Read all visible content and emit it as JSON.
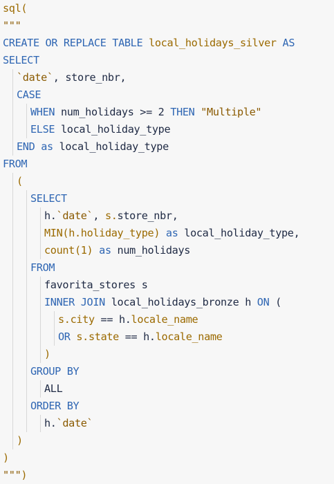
{
  "code_lines": [
    {
      "indent": 0,
      "tokens": [
        {
          "t": "sql",
          "c": "fn"
        },
        {
          "t": "(",
          "c": "fn"
        }
      ]
    },
    {
      "indent": 0,
      "tokens": [
        {
          "t": "\"\"\"",
          "c": "str"
        }
      ]
    },
    {
      "indent": 0,
      "tokens": [
        {
          "t": "CREATE OR REPLACE TABLE",
          "c": "kw"
        },
        {
          "t": " ",
          "c": "op"
        },
        {
          "t": "local_holidays_silver",
          "c": "fn"
        },
        {
          "t": " ",
          "c": "op"
        },
        {
          "t": "AS",
          "c": "kw"
        }
      ]
    },
    {
      "indent": 0,
      "tokens": [
        {
          "t": "SELECT",
          "c": "kw"
        }
      ]
    },
    {
      "indent": 1,
      "tokens": [
        {
          "t": "`date`",
          "c": "str"
        },
        {
          "t": ", store_nbr,",
          "c": "id"
        }
      ]
    },
    {
      "indent": 1,
      "tokens": [
        {
          "t": "CASE",
          "c": "kw"
        }
      ]
    },
    {
      "indent": 2,
      "tokens": [
        {
          "t": "WHEN",
          "c": "kw"
        },
        {
          "t": " num_holidays >= 2 ",
          "c": "id"
        },
        {
          "t": "THEN",
          "c": "kw"
        },
        {
          "t": " ",
          "c": "op"
        },
        {
          "t": "\"Multiple\"",
          "c": "str"
        }
      ]
    },
    {
      "indent": 2,
      "tokens": [
        {
          "t": "ELSE",
          "c": "kw"
        },
        {
          "t": " local_holiday_type",
          "c": "id"
        }
      ]
    },
    {
      "indent": 1,
      "tokens": [
        {
          "t": "END",
          "c": "kw"
        },
        {
          "t": " ",
          "c": "op"
        },
        {
          "t": "as",
          "c": "kw"
        },
        {
          "t": " local_holiday_type",
          "c": "id"
        }
      ]
    },
    {
      "indent": 0,
      "tokens": [
        {
          "t": "FROM",
          "c": "kw"
        }
      ]
    },
    {
      "indent": 1,
      "tokens": [
        {
          "t": "(",
          "c": "fn"
        }
      ]
    },
    {
      "indent": 2,
      "tokens": [
        {
          "t": "SELECT",
          "c": "kw"
        }
      ]
    },
    {
      "indent": 3,
      "tokens": [
        {
          "t": "h.",
          "c": "id"
        },
        {
          "t": "`date`",
          "c": "str"
        },
        {
          "t": ", ",
          "c": "id"
        },
        {
          "t": "s.",
          "c": "fn"
        },
        {
          "t": "store_nbr,",
          "c": "id"
        }
      ]
    },
    {
      "indent": 3,
      "tokens": [
        {
          "t": "MIN",
          "c": "fn"
        },
        {
          "t": "(",
          "c": "fn"
        },
        {
          "t": "h.holiday_type",
          "c": "fn"
        },
        {
          "t": ")",
          "c": "fn"
        },
        {
          "t": " ",
          "c": "op"
        },
        {
          "t": "as",
          "c": "kw"
        },
        {
          "t": " local_holiday_type,",
          "c": "id"
        }
      ]
    },
    {
      "indent": 3,
      "tokens": [
        {
          "t": "count(1)",
          "c": "fn"
        },
        {
          "t": " ",
          "c": "op"
        },
        {
          "t": "as",
          "c": "kw"
        },
        {
          "t": " num_holidays",
          "c": "id"
        }
      ]
    },
    {
      "indent": 2,
      "tokens": [
        {
          "t": "FROM",
          "c": "kw"
        }
      ]
    },
    {
      "indent": 3,
      "tokens": [
        {
          "t": "favorita_stores s",
          "c": "id"
        }
      ]
    },
    {
      "indent": 3,
      "tokens": [
        {
          "t": "INNER JOIN",
          "c": "kw"
        },
        {
          "t": " local_holidays_bronze h ",
          "c": "id"
        },
        {
          "t": "ON",
          "c": "kw"
        },
        {
          "t": " (",
          "c": "id"
        }
      ]
    },
    {
      "indent": 4,
      "tokens": [
        {
          "t": "s.city",
          "c": "fn"
        },
        {
          "t": " == ",
          "c": "id"
        },
        {
          "t": "h.",
          "c": "id"
        },
        {
          "t": "locale_name",
          "c": "fn"
        }
      ]
    },
    {
      "indent": 4,
      "tokens": [
        {
          "t": "OR",
          "c": "kw"
        },
        {
          "t": " ",
          "c": "op"
        },
        {
          "t": "s.state",
          "c": "fn"
        },
        {
          "t": " == ",
          "c": "id"
        },
        {
          "t": "h.",
          "c": "id"
        },
        {
          "t": "locale_name",
          "c": "fn"
        }
      ]
    },
    {
      "indent": 3,
      "tokens": [
        {
          "t": ")",
          "c": "fn"
        }
      ]
    },
    {
      "indent": 2,
      "tokens": [
        {
          "t": "GROUP BY",
          "c": "kw"
        }
      ]
    },
    {
      "indent": 3,
      "tokens": [
        {
          "t": "ALL",
          "c": "id"
        }
      ]
    },
    {
      "indent": 2,
      "tokens": [
        {
          "t": "ORDER BY",
          "c": "kw"
        }
      ]
    },
    {
      "indent": 3,
      "tokens": [
        {
          "t": "h.",
          "c": "id"
        },
        {
          "t": "`date`",
          "c": "str"
        }
      ]
    },
    {
      "indent": 1,
      "tokens": [
        {
          "t": ")",
          "c": "fn"
        }
      ]
    },
    {
      "indent": 0,
      "tokens": [
        {
          "t": ")",
          "c": "fn"
        }
      ]
    },
    {
      "indent": 0,
      "tokens": [
        {
          "t": "\"\"\"",
          "c": "str"
        },
        {
          "t": ")",
          "c": "fn"
        }
      ]
    }
  ],
  "colors": {
    "keyword": "#2f66b3",
    "function": "#9b6a00",
    "string": "#8a5a00",
    "identifier": "#1f2a44",
    "background": "#f7f7f7"
  }
}
